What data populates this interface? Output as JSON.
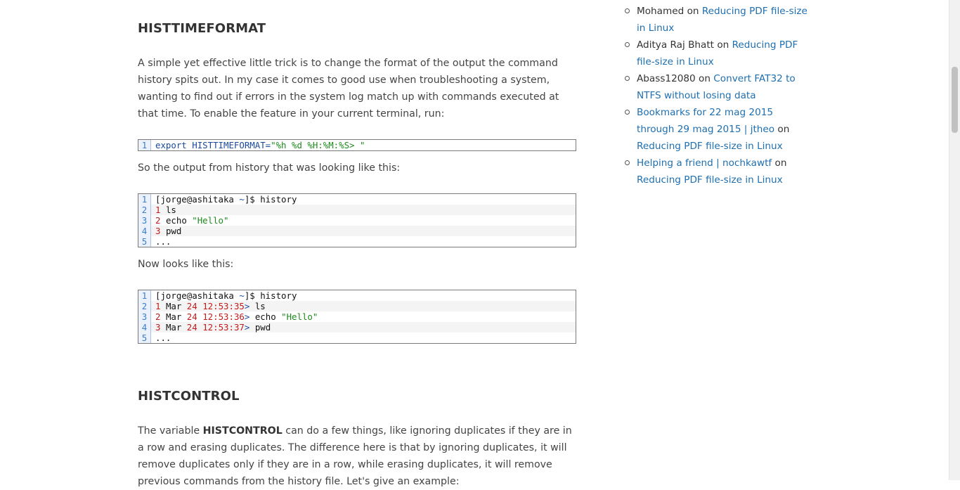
{
  "article": {
    "section1": {
      "heading": "HISTTIMEFORMAT",
      "intro": "A simple yet effective little trick is to change the format of the output the command history spits out. In my case it comes to good use when troubleshooting a system, wanting to find out if errors in the system log match up with commands executed at that time. To enable the feature in your current terminal, run:",
      "code1": {
        "line_numbers": [
          "1"
        ],
        "keyword": "export",
        "variable": "HISTTIMEFORMAT",
        "equals": "=",
        "value": "\"%h %d %H:%M:%S> \""
      },
      "before_text": "So the output from history that was looking like this:",
      "code2": {
        "line_numbers": [
          "1",
          "2",
          "3",
          "4",
          "5"
        ],
        "prompt_user": "[jorge@ashitaka",
        "prompt_dir": "~",
        "prompt_end": "]$ history",
        "rows": [
          {
            "num": "1",
            "cmd": "ls"
          },
          {
            "num": "2",
            "cmd": "echo",
            "arg": "\"Hello\""
          },
          {
            "num": "3",
            "cmd": "pwd"
          }
        ],
        "ellipsis": "..."
      },
      "after_text": "Now looks like this:",
      "code3": {
        "line_numbers": [
          "1",
          "2",
          "3",
          "4",
          "5"
        ],
        "prompt_user": "[jorge@ashitaka",
        "prompt_dir": "~",
        "prompt_end": "]$ history",
        "rows": [
          {
            "num": "1",
            "month": "Mar",
            "day": "24",
            "time": "12:53:35",
            "gt": ">",
            "cmd": "ls"
          },
          {
            "num": "2",
            "month": "Mar",
            "day": "24",
            "time": "12:53:36",
            "gt": ">",
            "cmd": "echo",
            "arg": "\"Hello\""
          },
          {
            "num": "3",
            "month": "Mar",
            "day": "24",
            "time": "12:53:37",
            "gt": ">",
            "cmd": "pwd"
          }
        ],
        "ellipsis": "..."
      }
    },
    "section2": {
      "heading": "HISTCONTROL",
      "text_start": "The variable ",
      "text_bold": "HISTCONTROL",
      "text_rest": " can do a few things, like ignoring duplicates if they are in a row and erasing duplicates. The difference here is that by ignoring duplicates, it will remove duplicates only if they are in a row, while erasing duplicates, it will remove previous commands from the history file. Let's give an example:"
    }
  },
  "sidebar": {
    "comments": [
      {
        "author": "Mohamed",
        "on": "on",
        "post": "Reducing PDF file-size in Linux",
        "author_link": false
      },
      {
        "author": "Aditya Raj Bhatt",
        "on": "on",
        "post": "Reducing PDF file-size in Linux",
        "author_link": false
      },
      {
        "author": "Abass12080",
        "on": "on",
        "post": "Convert FAT32 to NTFS without losing data",
        "author_link": false
      },
      {
        "author": "Bookmarks for 22 mag 2015 through 29 mag 2015 | jtheo",
        "on": "on",
        "post": "Reducing PDF file-size in Linux",
        "author_link": true
      },
      {
        "author": "Helping a friend | nochkawtf",
        "on": "on",
        "post": "Reducing PDF file-size in Linux",
        "author_link": true
      }
    ]
  },
  "colors": {
    "link": "#1e6fb0",
    "heading": "#333333",
    "body_text": "#444444",
    "code_keyword": "#1a4a9e",
    "code_string": "#1d8a1d",
    "code_number": "#c41a1a"
  }
}
